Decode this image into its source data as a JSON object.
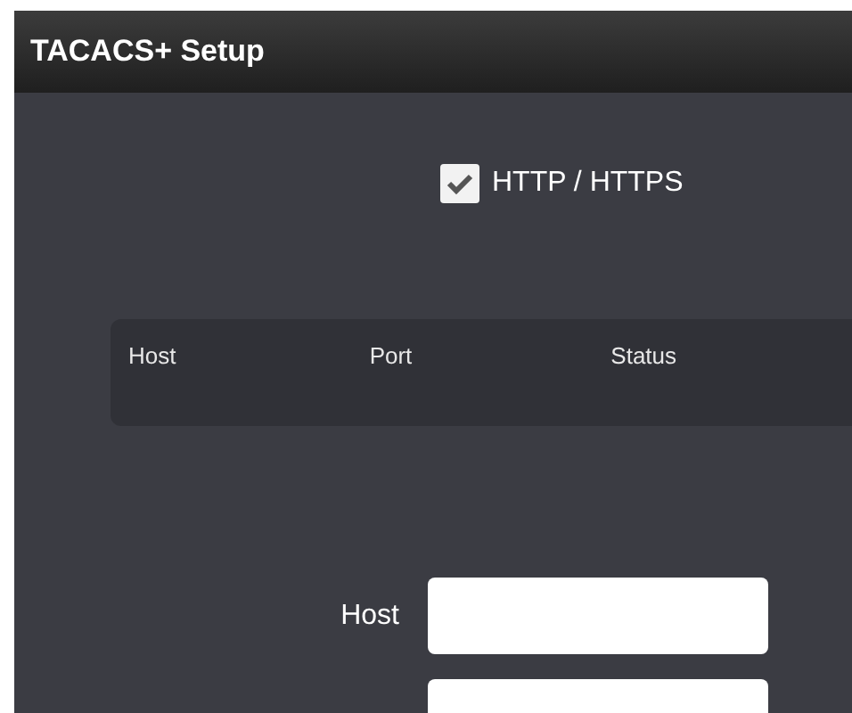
{
  "window": {
    "title": "TACACS+ Setup"
  },
  "protocol": {
    "label": "HTTP / HTTPS",
    "checked": true
  },
  "table": {
    "columns": [
      "Host",
      "Port",
      "Status"
    ]
  },
  "form": {
    "fields": [
      {
        "label": "Host"
      }
    ]
  }
}
